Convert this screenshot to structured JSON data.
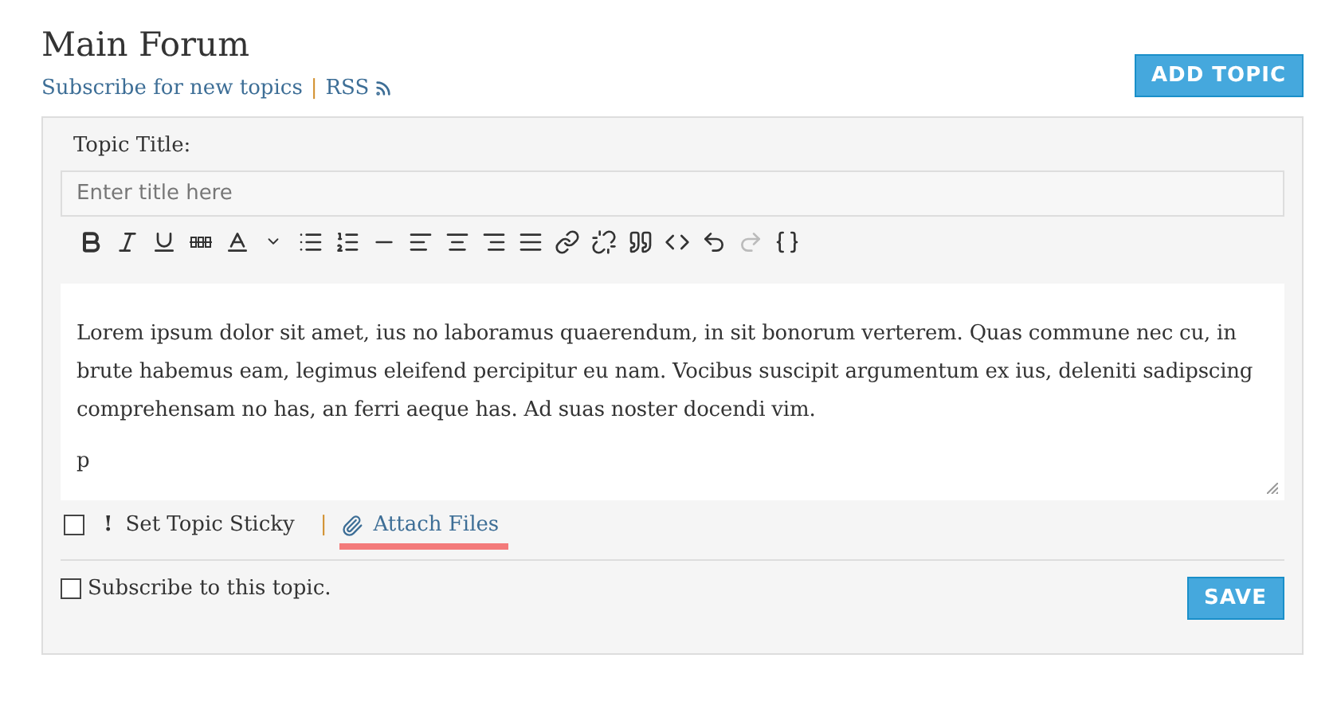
{
  "forum": {
    "title": "Main Forum",
    "subscribe_link": "Subscribe for new topics",
    "separator": "|",
    "rss_link": "RSS",
    "add_button": "ADD TOPIC"
  },
  "form": {
    "title_label": "Topic Title:",
    "title_placeholder": "Enter title here",
    "toolbar": [
      {
        "kind": "bold",
        "disabled": false
      },
      {
        "kind": "italic",
        "disabled": false
      },
      {
        "kind": "underline",
        "disabled": false
      },
      {
        "kind": "strike",
        "disabled": false
      },
      {
        "kind": "color",
        "disabled": false
      },
      {
        "kind": "dropdown",
        "disabled": false
      },
      {
        "kind": "bullets",
        "disabled": false
      },
      {
        "kind": "numbers",
        "disabled": false
      },
      {
        "kind": "rule",
        "disabled": false
      },
      {
        "kind": "left",
        "disabled": false
      },
      {
        "kind": "center",
        "disabled": false
      },
      {
        "kind": "right",
        "disabled": false
      },
      {
        "kind": "justify",
        "disabled": false
      },
      {
        "kind": "link",
        "disabled": false
      },
      {
        "kind": "unlink",
        "disabled": false
      },
      {
        "kind": "quote",
        "disabled": false
      },
      {
        "kind": "code",
        "disabled": false
      },
      {
        "kind": "undo",
        "disabled": false
      },
      {
        "kind": "redo",
        "disabled": true
      },
      {
        "kind": "braces",
        "disabled": false
      }
    ],
    "body": "Lorem ipsum dolor sit amet, ius no laboramus quaerendum, in sit bonorum verterem. Quas commune nec cu, in brute habemus eam, legimus eleifend percipitur eu nam. Vocibus suscipit argumentum ex ius, deleniti sadipscing comprehensam no has, an ferri aeque has. Ad suas noster docendi vim.",
    "path": "p",
    "sticky": {
      "label": "Set Topic Sticky",
      "mark": "!",
      "checked": false
    },
    "separator": "|",
    "attach": {
      "label": "Attach Files",
      "highlighted": true
    },
    "subscribe": {
      "label": "Subscribe to this topic.",
      "checked": false
    },
    "save_button": "SAVE"
  }
}
